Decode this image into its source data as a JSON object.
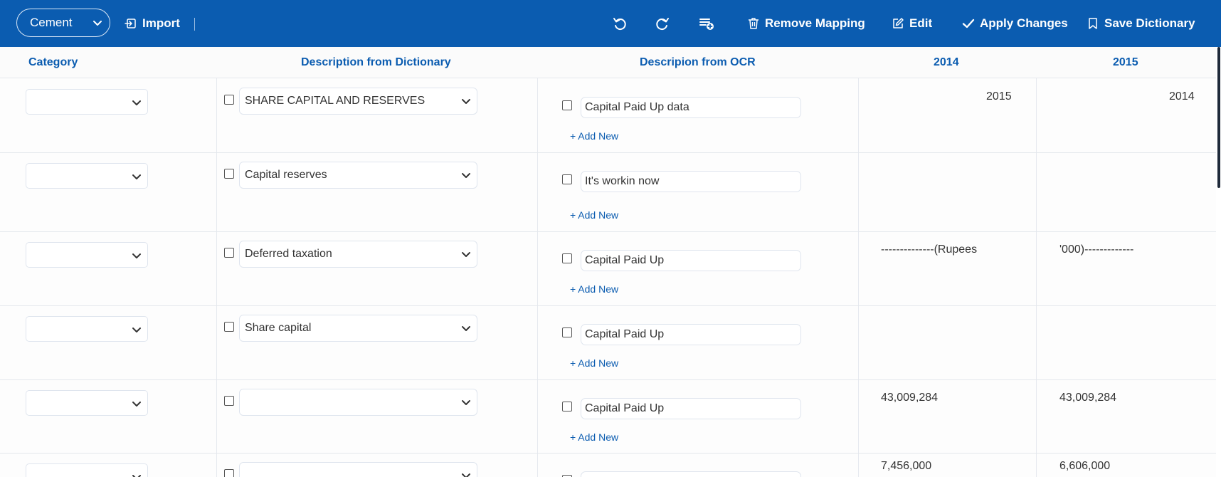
{
  "toolbar": {
    "dataset_select": "Cement",
    "import_label": "Import",
    "remove_mapping_label": "Remove Mapping",
    "edit_label": "Edit",
    "apply_changes_label": "Apply Changes",
    "save_dictionary_label": "Save Dictionary",
    "background_color": "#0b5cb0"
  },
  "table": {
    "headers": {
      "category": "Category",
      "description_dictionary": "Description from Dictionary",
      "description_ocr": "Descripion from OCR",
      "year_1": "2014",
      "year_2": "2015"
    },
    "add_new_label": "+ Add New",
    "rows": [
      {
        "category": "",
        "dictionary": "SHARE CAPITAL AND RESERVES",
        "ocr": "Capital Paid Up data",
        "year_1": "2015",
        "year_2": "2014"
      },
      {
        "category": "",
        "dictionary": "Capital reserves",
        "ocr": "It's workin now",
        "year_1": "",
        "year_2": ""
      },
      {
        "category": "",
        "dictionary": "Deferred taxation",
        "ocr": "Capital Paid Up",
        "year_1": "--------------(Rupees",
        "year_2": "'000)-------------"
      },
      {
        "category": "",
        "dictionary": "Share capital",
        "ocr": "Capital Paid Up",
        "year_1": "",
        "year_2": ""
      },
      {
        "category": "",
        "dictionary": "",
        "ocr": "Capital Paid Up",
        "year_1": "43,009,284",
        "year_2": "43,009,284"
      },
      {
        "category": "",
        "dictionary": "",
        "ocr": "",
        "year_1": "7,456,000",
        "year_2": "6,606,000"
      }
    ]
  }
}
